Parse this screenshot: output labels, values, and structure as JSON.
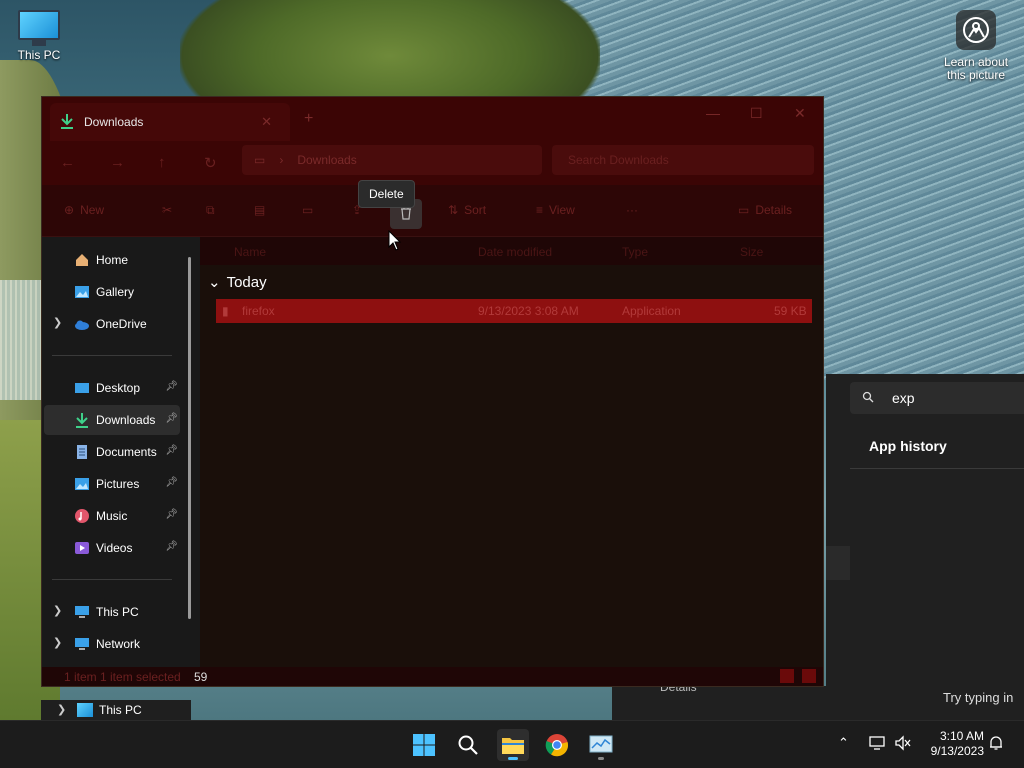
{
  "desktop": {
    "this_pc_label": "This PC",
    "learn_label_1": "Learn about",
    "learn_label_2": "this picture"
  },
  "explorer": {
    "tab_title": "Downloads",
    "tab_close": "✕",
    "new_tab": "+",
    "minimize": "—",
    "maximize": "☐",
    "close": "✕",
    "address_path": "Downloads",
    "search_placeholder": "Search Downloads",
    "toolbar": {
      "new_label": "New",
      "sort_label": "Sort",
      "view_label": "View",
      "more_label": "···",
      "details_label": "Details"
    },
    "tooltip": "Delete",
    "columns": [
      "Name",
      "Date modified",
      "Type",
      "Size"
    ],
    "group_label": "Today",
    "file": {
      "name": "firefox",
      "date": "9/13/2023 3:08 AM",
      "type": "Application",
      "size": "59 KB"
    },
    "status_text": "1 item   1 item selected",
    "status_size": "59"
  },
  "nav_pane": {
    "items": [
      {
        "label": "Home"
      },
      {
        "label": "Gallery"
      },
      {
        "label": "OneDrive"
      },
      {
        "label": "Desktop"
      },
      {
        "label": "Downloads"
      },
      {
        "label": "Documents"
      },
      {
        "label": "Pictures"
      },
      {
        "label": "Music"
      },
      {
        "label": "Videos"
      },
      {
        "label": "This PC"
      },
      {
        "label": "Network"
      }
    ],
    "bottom_this_pc": "This PC"
  },
  "search_panel": {
    "query": "exp",
    "app_history": "App history",
    "hint": "Try typing in",
    "details": "Details"
  },
  "taskbar": {
    "time": "3:10 AM",
    "date": "9/13/2023"
  },
  "colors": {
    "accent": "#4cc2ff",
    "explorer_tint": "#3b0505",
    "selected_row": "#8e1010"
  }
}
